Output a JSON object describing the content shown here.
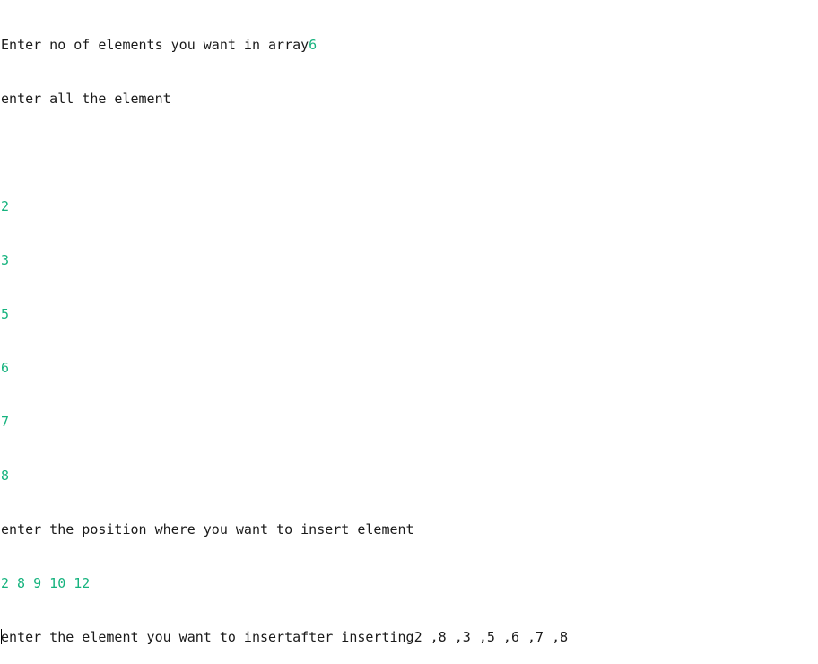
{
  "colors": {
    "output_text": "#1a1a1a",
    "user_input": "#16b37e",
    "background": "#ffffff"
  },
  "console": {
    "prompt_count": "Enter no of elements you want in array",
    "input_count": "6",
    "prompt_elements": "enter all the element",
    "input_elements": [
      "2",
      "3",
      "5",
      "6",
      "7",
      "8"
    ],
    "prompt_position": "enter the position where you want to insert element",
    "input_position_line": "2 8 9 10 12",
    "prompt_insert": "enter the element you want to insert",
    "result_text": "after inserting2 ,8 ,3 ,5 ,6 ,7 ,8"
  }
}
